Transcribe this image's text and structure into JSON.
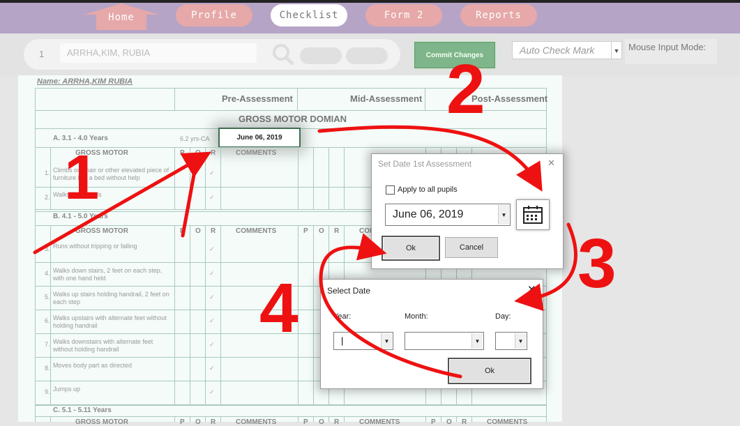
{
  "nav": {
    "tabs": [
      "Home",
      "Profile",
      "Checklist",
      "Form 2",
      "Reports"
    ],
    "active_tab": "Checklist"
  },
  "toolbar": {
    "pupil_number": "1",
    "pupil_name": "ARRHA,KIM, RUBIA",
    "commit_label": "Commit Changes",
    "auto_check_placeholder": "Auto Check Mark",
    "mouse_mode_label": "Mouse Input Mode:"
  },
  "sheet": {
    "name_label": "Name: ARRHA,KIM RUBIA",
    "phases": [
      "Pre-Assessment",
      "Mid-Assessment",
      "Post-Assessment"
    ],
    "domain_title": "GROSS MOTOR DOMIAN",
    "age_in_years": "6.2 yrs-CA",
    "selected_date": "June 06, 2019",
    "col_headers": [
      "P",
      "O",
      "R",
      "COMMENTS"
    ],
    "sections": [
      {
        "title": "A. 3.1 - 4.0 Years",
        "subhead": "GROSS MOTOR",
        "items": [
          {
            "no": "1.",
            "text": "Climbs on chair or other elevated piece of furniture like a bed without help"
          },
          {
            "no": "2.",
            "text": "Walks backwards"
          }
        ]
      },
      {
        "title": "B. 4.1 - 5.0 Years",
        "subhead": "GROSS MOTOR",
        "items": [
          {
            "no": "3.",
            "text": "Runs without tripping or falling"
          },
          {
            "no": "4.",
            "text": "Walks down stairs, 2 feet on each step, with one hand held"
          },
          {
            "no": "5.",
            "text": "Walks up stairs holding handrail, 2 feet on each step"
          },
          {
            "no": "6.",
            "text": "Walks upstairs with alternate feet without holding handrail"
          },
          {
            "no": "7.",
            "text": "Walks downstairs with alternate feet without holding handrail"
          },
          {
            "no": "8.",
            "text": "Moves body part as directed"
          },
          {
            "no": "9.",
            "text": "Jumps up"
          }
        ]
      },
      {
        "title": "C. 5.1 - 5.11 Years",
        "subhead": "GROSS MOTOR",
        "items": []
      }
    ],
    "check_mark": "✓"
  },
  "set_date_dialog": {
    "title": "Set Date 1st Assessment",
    "apply_all_label": "Apply to all pupils",
    "date_value": "June 06, 2019",
    "ok_label": "Ok",
    "cancel_label": "Cancel",
    "calendar_icon": "calendar-icon"
  },
  "select_date_dialog": {
    "title": "Select Date",
    "year_label": "Year:",
    "month_label": "Month:",
    "day_label": "Day:",
    "ok_label": "Ok"
  },
  "annotations": {
    "step_numbers": [
      "1",
      "2",
      "3",
      "4"
    ],
    "color": "#ee1111"
  }
}
